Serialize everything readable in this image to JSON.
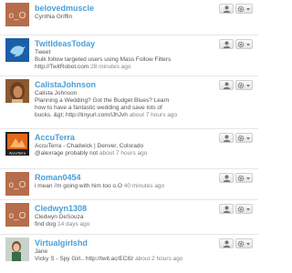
{
  "users": [
    {
      "handle": "belovedmuscle",
      "lines": [
        "Cynthia Griffin"
      ],
      "meta": "",
      "avatar": "default-oo",
      "avatar_color": "#b56d4c"
    },
    {
      "handle": "TwitIdeasToday",
      "lines": [
        "Tweet",
        "Bulk follow targeted users using Mass Follow Filters",
        "http://TwitRobot.com"
      ],
      "meta": "28 minutes ago",
      "avatar": "bird-logo",
      "avatar_color": "#1b5fa8"
    },
    {
      "handle": "CalistaJohnson",
      "lines": [
        "Calista Johnson",
        "Planning a Wedding? Got the Budget Blues? Learn",
        "how to have a fantastic wedding and save lots of",
        "bucks. &gt; http://tinyurl.com/lJhJvh"
      ],
      "meta": "about 7 hours ago",
      "avatar": "portrait-woman",
      "avatar_color": "#c9895a"
    },
    {
      "handle": "AccuTerra",
      "lines": [
        "AccuTerra - Chadwick | Denver, Colorado",
        "@alexrage probably not"
      ],
      "meta": "about 7 hours ago",
      "avatar": "accuterra-logo",
      "avatar_color": "#e06a1a"
    },
    {
      "handle": "Roman0454",
      "lines": [
        "i mean i'm going with him too o.O"
      ],
      "meta": "40 minutes ago",
      "avatar": "default-oo",
      "avatar_color": "#b56d4c"
    },
    {
      "handle": "Cledwyn1308",
      "lines": [
        "Cledwyn DeSouza",
        "find dog"
      ],
      "meta": "14 days ago",
      "avatar": "default-oo",
      "avatar_color": "#b56d4c"
    },
    {
      "handle": "Virtualgirlshd",
      "lines": [
        "Jane",
        "Vicky S - Spy Girl.. http://twit.ac/EC8z"
      ],
      "meta": "about 2 hours ago",
      "avatar": "portrait-girl",
      "avatar_color": "#c9d3cc"
    }
  ]
}
